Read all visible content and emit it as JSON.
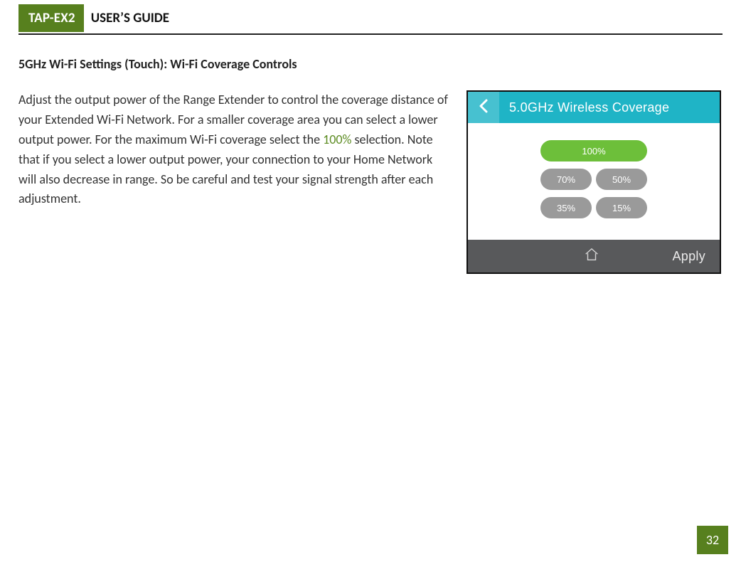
{
  "header": {
    "tab": "TAP-EX2",
    "title": "USER’S GUIDE"
  },
  "section": {
    "heading_prefix": "5GHz",
    "heading_rest": " Wi-Fi Settings (Touch): Wi-Fi Coverage Controls"
  },
  "body": {
    "text_before_green": "Adjust the output power of the Range Extender to control the coverage distance of your Extended Wi-Fi Network. For a smaller coverage area you can select a lower output power. For the maximum Wi-Fi coverage select the ",
    "green_text": "100%",
    "text_after_green": " selection. Note that if you select a lower output power, your connection to your Home Network will also decrease in range. So be careful and test your signal strength after each adjustment."
  },
  "device": {
    "header_title": "5.0GHz Wireless Coverage",
    "options": {
      "selected": "100%",
      "row1": [
        "70%",
        "50%"
      ],
      "row2": [
        "35%",
        "15%"
      ]
    },
    "footer_apply": "Apply"
  },
  "page_number": "32"
}
